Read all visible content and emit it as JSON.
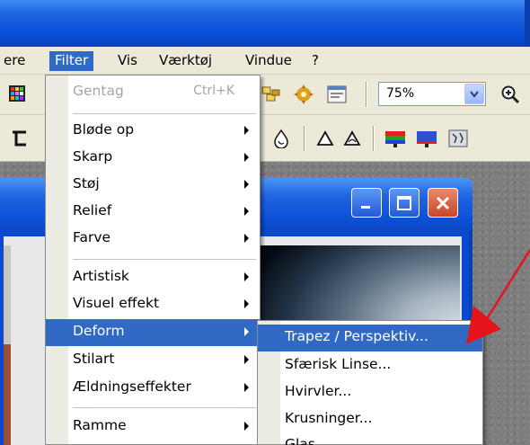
{
  "menubar": {
    "items": [
      {
        "label": "ere"
      },
      {
        "label": "Filter",
        "active": true
      },
      {
        "label": "Vis"
      },
      {
        "label": "Værktøj"
      },
      {
        "label": "Vindue"
      },
      {
        "label": "?"
      }
    ]
  },
  "toolbar": {
    "zoom_value": "75%"
  },
  "filter_menu": {
    "items": [
      {
        "label": "Gentag",
        "shortcut": "Ctrl+K",
        "disabled": true
      },
      {
        "label": "Bløde op",
        "submenu": true
      },
      {
        "label": "Skarp",
        "submenu": true
      },
      {
        "label": "Støj",
        "submenu": true
      },
      {
        "label": "Relief",
        "submenu": true
      },
      {
        "label": "Farve",
        "submenu": true
      },
      {
        "label": "Artistisk",
        "submenu": true
      },
      {
        "label": "Visuel effekt",
        "submenu": true
      },
      {
        "label": "Deform",
        "submenu": true,
        "highlighted": true
      },
      {
        "label": "Stilart",
        "submenu": true
      },
      {
        "label": "Ældningseffekter",
        "submenu": true
      },
      {
        "label": "Ramme",
        "submenu": true
      }
    ]
  },
  "deform_menu": {
    "items": [
      {
        "label": "Trapez / Perspektiv...",
        "highlighted": true
      },
      {
        "label": "Sfærisk Linse..."
      },
      {
        "label": "Hvirvler..."
      },
      {
        "label": "Krusninger..."
      },
      {
        "label": "Glas..."
      }
    ]
  },
  "colors": {
    "menu_highlight": "#316ac5",
    "title_bar": "#0a4fd8",
    "annotation_arrow": "#e3151a"
  }
}
